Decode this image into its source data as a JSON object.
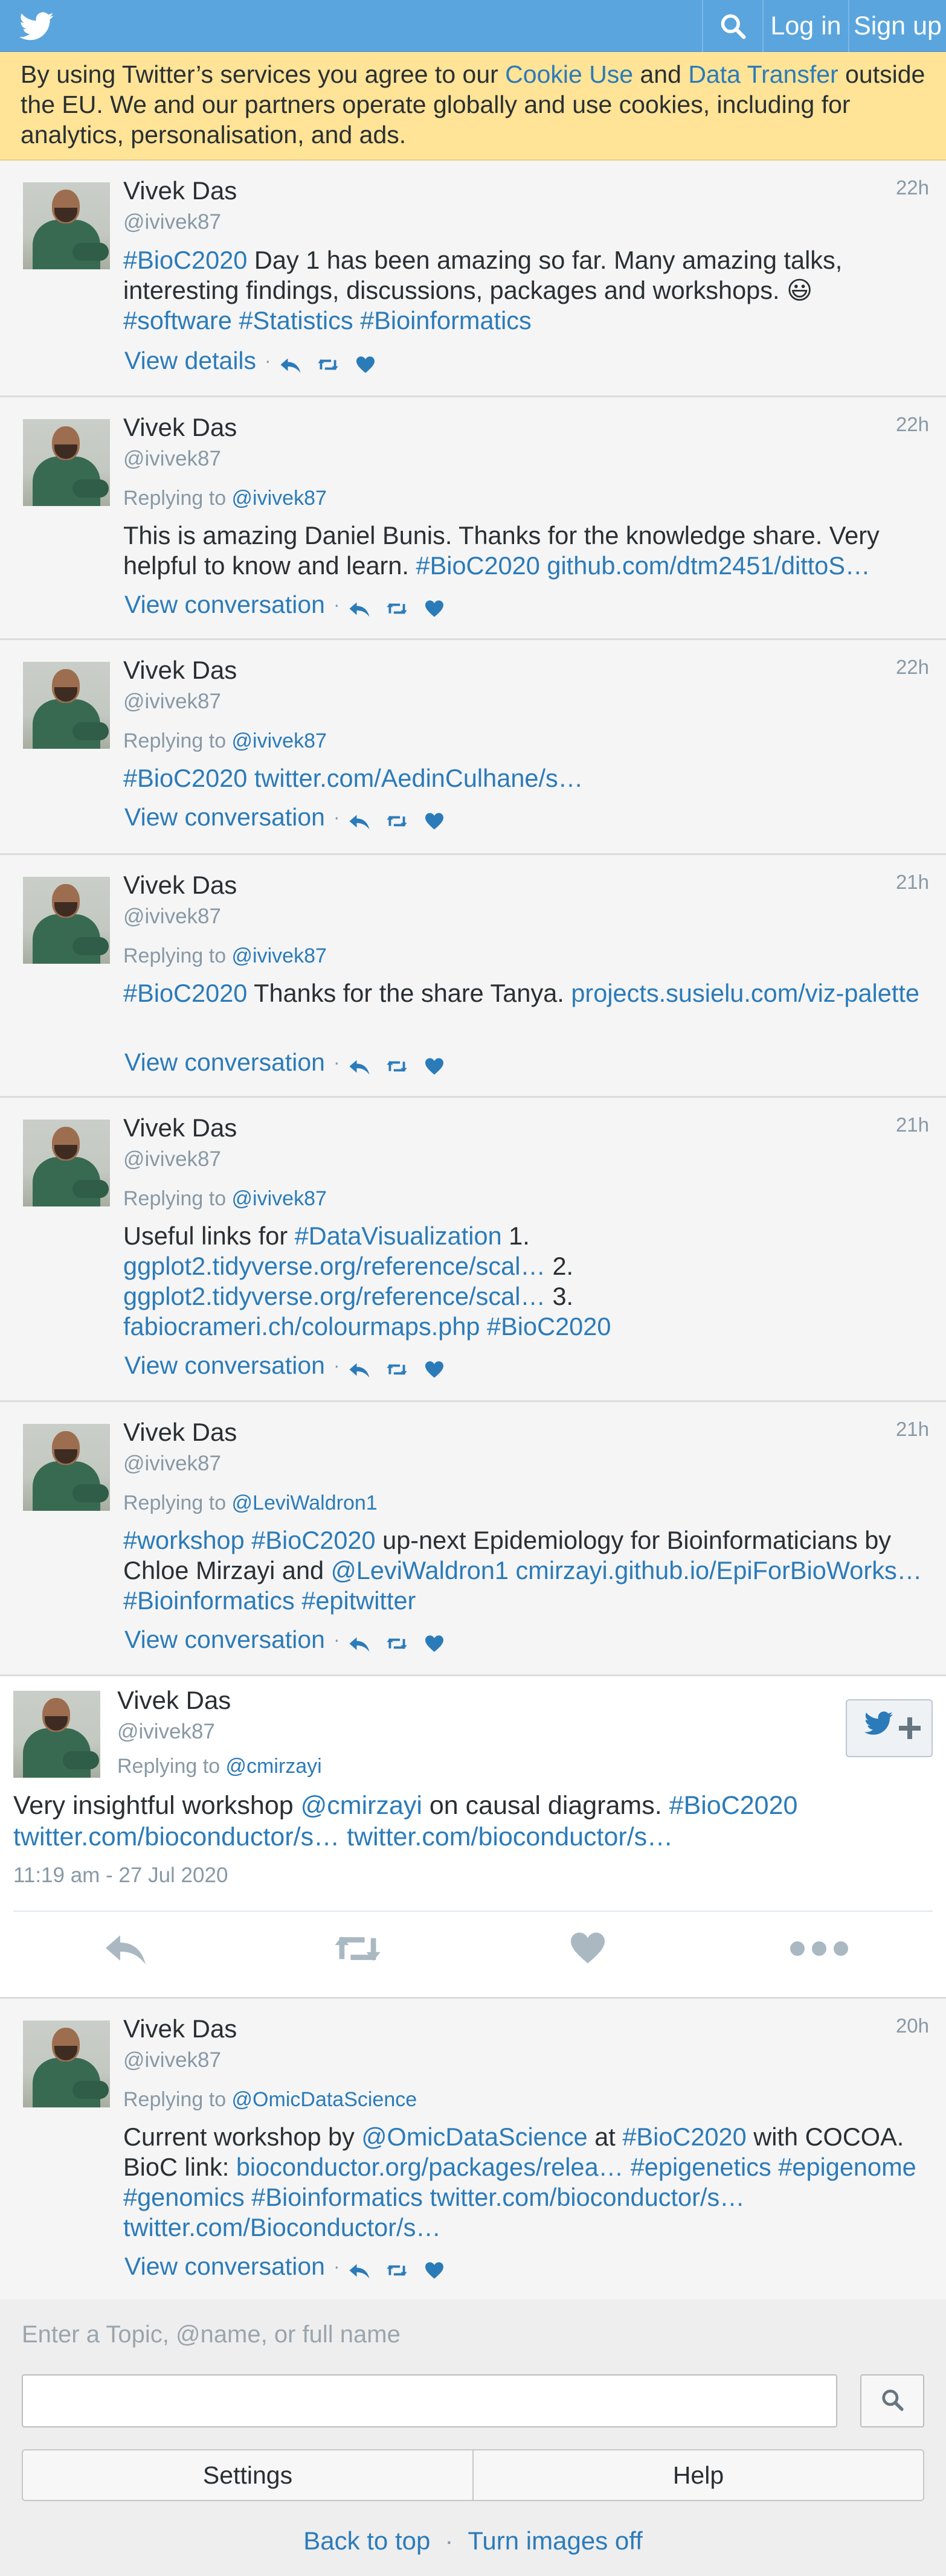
{
  "topbar": {
    "logo": "twitter-bird-icon",
    "search_icon": "search-icon",
    "login": "Log in",
    "signup": "Sign up",
    "color": "#5aa5dd"
  },
  "cookie": {
    "t1": "By using Twitter’s services you agree to our ",
    "l1": "Cookie Use",
    "t2": " and ",
    "l2": "Data Transfer",
    "t3": " outside the EU. We and our partners operate globally and use cookies, including for analytics, personalisation, and ads."
  },
  "tweets": [
    {
      "name": "Vivek Das",
      "handle": "@ivivek87",
      "time": "22h",
      "segments": [
        "#BioC2020",
        " Day 1 has been amazing so far. Many amazing talks, interesting findings, discussions, packages and workshops. 😃 ",
        "#software",
        " ",
        "#Statistics",
        " ",
        "#Bioinformatics"
      ],
      "action": "View details"
    },
    {
      "name": "Vivek Das",
      "handle": "@ivivek87",
      "time": "22h",
      "reply_label": "Replying to ",
      "reply_to": "@ivivek87",
      "segments": [
        "This is amazing Daniel Bunis. Thanks for the knowledge share. Very helpful to know and learn. ",
        "#BioC2020",
        " ",
        "github.com/dtm2451/dittoS…"
      ],
      "action": "View conversation"
    },
    {
      "name": "Vivek Das",
      "handle": "@ivivek87",
      "time": "22h",
      "reply_label": "Replying to ",
      "reply_to": "@ivivek87",
      "segments": [
        "#BioC2020",
        " ",
        "twitter.com/AedinCulhane/s…"
      ],
      "action": "View conversation"
    },
    {
      "name": "Vivek Das",
      "handle": "@ivivek87",
      "time": "21h",
      "reply_label": "Replying to ",
      "reply_to": "@ivivek87",
      "segments": [
        "#BioC2020",
        " Thanks for the share Tanya. ",
        "projects.susielu.com/viz-palette"
      ],
      "action": "View conversation"
    },
    {
      "name": "Vivek Das",
      "handle": "@ivivek87",
      "time": "21h",
      "reply_label": "Replying to ",
      "reply_to": "@ivivek87",
      "segments": [
        "Useful links for ",
        "#DataVisualization",
        " 1. ",
        "ggplot2.tidyverse.org/reference/scal…",
        " 2. ",
        "ggplot2.tidyverse.org/reference/scal…",
        " 3. ",
        "fabiocrameri.ch/colourmaps.php",
        " ",
        "#BioC2020"
      ],
      "action": "View conversation"
    },
    {
      "name": "Vivek Das",
      "handle": "@ivivek87",
      "time": "21h",
      "reply_label": "Replying to ",
      "reply_to": "@LeviWaldron1",
      "segments": [
        "#workshop",
        " ",
        "#BioC2020",
        " up-next Epidemiology for Bioinformaticians by Chloe Mirzayi and ",
        "@LeviWaldron1",
        " ",
        "cmirzayi.github.io/EpiForBioWorks…",
        " ",
        "#Bioinformatics",
        " ",
        "#epitwitter"
      ],
      "action": "View conversation"
    }
  ],
  "focused": {
    "name": "Vivek Das",
    "handle": "@ivivek87",
    "reply_label": "Replying to ",
    "reply_to": "@cmirzayi",
    "segments": [
      "Very insightful workshop ",
      "@cmirzayi",
      " on causal diagrams. ",
      "#BioC2020",
      " ",
      "twitter.com/bioconductor/s…",
      " ",
      "twitter.com/bioconductor/s…"
    ],
    "timestamp": "11:19 am - 27 Jul 2020",
    "follow_icon": "follow-plus-icon"
  },
  "last_tweet": {
    "name": "Vivek Das",
    "handle": "@ivivek87",
    "time": "20h",
    "reply_label": "Replying to ",
    "reply_to": "@OmicDataScience",
    "segments": [
      "Current workshop by ",
      "@OmicDataScience",
      " at ",
      "#BioC2020",
      " with COCOA. BioC link: ",
      "bioconductor.org/packages/relea…",
      " ",
      "#epigenetics",
      " ",
      "#epigenome",
      " ",
      "#genomics",
      " ",
      "#Bioinformatics",
      " ",
      "twitter.com/bioconductor/s…",
      " ",
      "twitter.com/Bioconductor/s…"
    ],
    "action": "View conversation"
  },
  "bottom": {
    "search_label": "Enter a Topic, @name, or full name",
    "search_value": "",
    "settings": "Settings",
    "help": "Help",
    "back_to_top": "Back to top",
    "images_off": "Turn images off"
  },
  "colors": {
    "link": "#2b7bb9",
    "muted": "#8899a6",
    "banner": "#ffe396"
  }
}
